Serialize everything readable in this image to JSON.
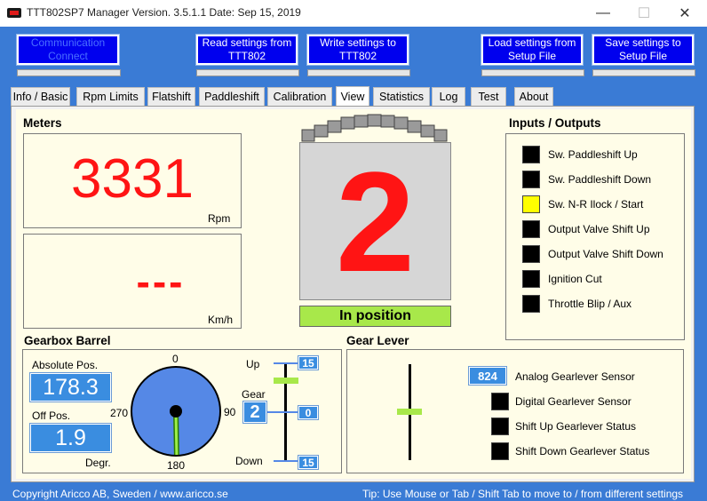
{
  "window": {
    "title": "TTT802SP7 Manager Version. 3.5.1.1  Date: Sep 15, 2019",
    "minimize": "—",
    "maximize": "☐",
    "close": "✕"
  },
  "toolbar": {
    "communication": "Communication\nConnect",
    "read_settings": "Read settings from\nTTT802",
    "write_settings": "Write settings to\nTTT802",
    "load_settings": "Load settings from\nSetup File",
    "save_settings": "Save settings to\nSetup File"
  },
  "tabs": [
    "Info / Basic",
    "Rpm Limits",
    "Flatshift",
    "Paddleshift",
    "Calibration",
    "View",
    "Statistics",
    "Log",
    "Test",
    "About"
  ],
  "active_tab": "View",
  "meters": {
    "title": "Meters",
    "rpm_value": "3331",
    "rpm_unit": "Rpm",
    "speed_value": "---",
    "speed_unit": "Km/h"
  },
  "gear_display": {
    "gear": "2",
    "status": "In position",
    "status_color": "#a8e84a"
  },
  "inputs_outputs": {
    "title": "Inputs / Outputs",
    "items": [
      {
        "label": "Sw. Paddleshift Up",
        "color": "#000000"
      },
      {
        "label": "Sw. Paddleshift Down",
        "color": "#000000"
      },
      {
        "label": "Sw. N-R Ilock / Start",
        "color": "#ffff00"
      },
      {
        "label": "Output Valve Shift Up",
        "color": "#000000"
      },
      {
        "label": "Output Valve Shift Down",
        "color": "#000000"
      },
      {
        "label": "Ignition Cut",
        "color": "#000000"
      },
      {
        "label": "Throttle Blip / Aux",
        "color": "#000000"
      }
    ]
  },
  "gearbox_barrel": {
    "title": "Gearbox Barrel",
    "absolute_pos_label": "Absolute Pos.",
    "absolute_pos_value": "178.3",
    "off_pos_label": "Off Pos.",
    "off_pos_value": "1.9",
    "degr_label": "Degr.",
    "dial_top": "0",
    "dial_right": "90",
    "dial_bottom": "180",
    "dial_left": "270",
    "up_label": "Up",
    "up_value": "15",
    "gear_label": "Gear",
    "gear_value": "2",
    "gear_offset": "0",
    "down_label": "Down",
    "down_value": "15"
  },
  "gear_lever": {
    "title": "Gear Lever",
    "analog_value": "824",
    "analog_label": "Analog Gearlever Sensor",
    "digital_label": "Digital Gearlever Sensor",
    "shift_up_label": "Shift Up Gearlever Status",
    "shift_down_label": "Shift Down Gearlever Status"
  },
  "footer": {
    "copyright": "Copyright Aricco AB, Sweden / www.aricco.se",
    "tip": "Tip:  Use Mouse or Tab / Shift Tab to move to / from  different settings"
  }
}
